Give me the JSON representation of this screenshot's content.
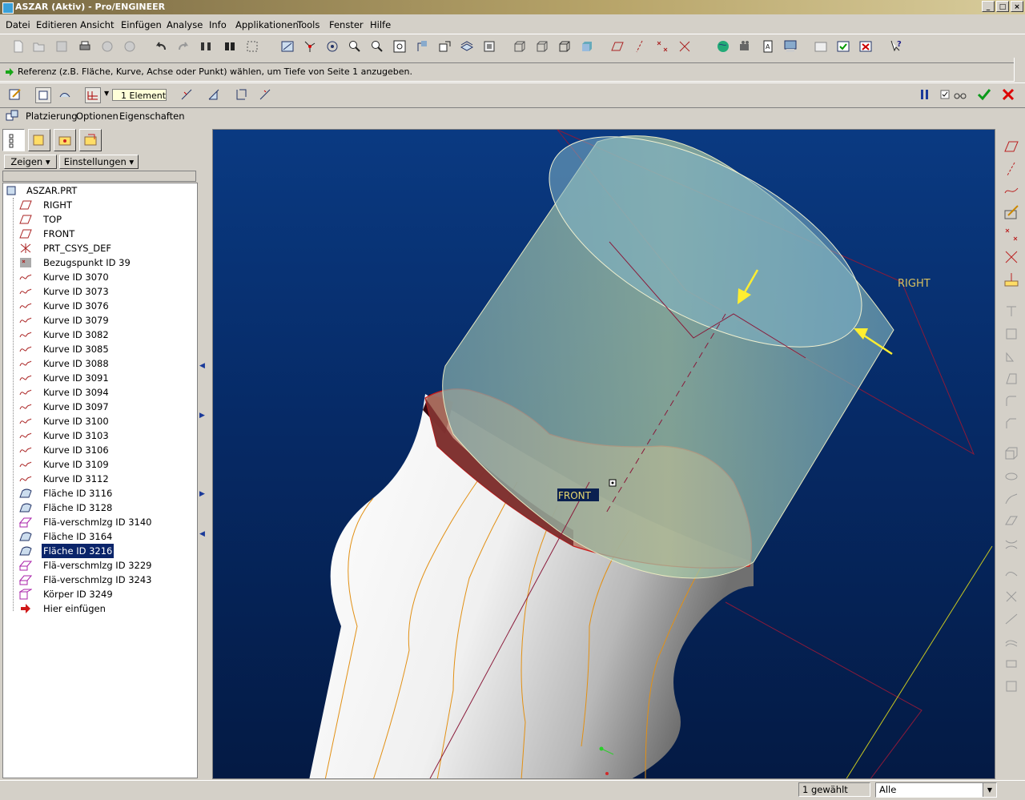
{
  "window": {
    "title": "ASZAR (Aktiv) - Pro/ENGINEER"
  },
  "menu": [
    "Datei",
    "Editieren",
    "Ansicht",
    "Einfügen",
    "Analyse",
    "Info",
    "Applikationen",
    "Tools",
    "Fenster",
    "Hilfe"
  ],
  "message": "Referenz (z.B. Fläche, Kurve, Achse oder Punkt) wählen, um Tiefe von Seite 1 anzugeben.",
  "dashboard": {
    "element_count": "1 Element(e)"
  },
  "dash_tabs": [
    "Platzierung",
    "Optionen",
    "Eigenschaften"
  ],
  "nav": {
    "show_label": "Zeigen",
    "settings_label": "Einstellungen"
  },
  "tree": [
    {
      "label": "ASZAR.PRT",
      "icon": "part-icon"
    },
    {
      "label": "RIGHT",
      "icon": "datum-plane-icon"
    },
    {
      "label": "TOP",
      "icon": "datum-plane-icon"
    },
    {
      "label": "FRONT",
      "icon": "datum-plane-icon"
    },
    {
      "label": "PRT_CSYS_DEF",
      "icon": "csys-icon"
    },
    {
      "label": "Bezugspunkt ID 39",
      "icon": "datum-point-icon"
    },
    {
      "label": "Kurve ID 3070",
      "icon": "curve-icon"
    },
    {
      "label": "Kurve ID 3073",
      "icon": "curve-icon"
    },
    {
      "label": "Kurve ID 3076",
      "icon": "curve-icon"
    },
    {
      "label": "Kurve ID 3079",
      "icon": "curve-icon"
    },
    {
      "label": "Kurve ID 3082",
      "icon": "curve-icon"
    },
    {
      "label": "Kurve ID 3085",
      "icon": "curve-icon"
    },
    {
      "label": "Kurve ID 3088",
      "icon": "curve-icon"
    },
    {
      "label": "Kurve ID 3091",
      "icon": "curve-icon"
    },
    {
      "label": "Kurve ID 3094",
      "icon": "curve-icon"
    },
    {
      "label": "Kurve ID 3097",
      "icon": "curve-icon"
    },
    {
      "label": "Kurve ID 3100",
      "icon": "curve-icon"
    },
    {
      "label": "Kurve ID 3103",
      "icon": "curve-icon"
    },
    {
      "label": "Kurve ID 3106",
      "icon": "curve-icon"
    },
    {
      "label": "Kurve ID 3109",
      "icon": "curve-icon"
    },
    {
      "label": "Kurve ID 3112",
      "icon": "curve-icon"
    },
    {
      "label": "Fläche ID 3116",
      "icon": "surface-icon"
    },
    {
      "label": "Fläche ID 3128",
      "icon": "surface-icon"
    },
    {
      "label": "Flä-verschmlzg ID 3140",
      "icon": "merge-icon"
    },
    {
      "label": "Fläche ID 3164",
      "icon": "surface-icon"
    },
    {
      "label": "Fläche ID 3216",
      "icon": "surface-icon"
    },
    {
      "label": "Flä-verschmlzg ID 3229",
      "icon": "merge-icon"
    },
    {
      "label": "Flä-verschmlzg ID 3243",
      "icon": "merge-icon"
    },
    {
      "label": "Körper ID 3249",
      "icon": "solid-icon"
    },
    {
      "label": "Hier einfügen",
      "icon": "insert-here-icon"
    }
  ],
  "viewport": {
    "label_right": "RIGHT",
    "label_front": "FRONT"
  },
  "status": {
    "selected": "1 gewählt",
    "filter": "Alle"
  }
}
